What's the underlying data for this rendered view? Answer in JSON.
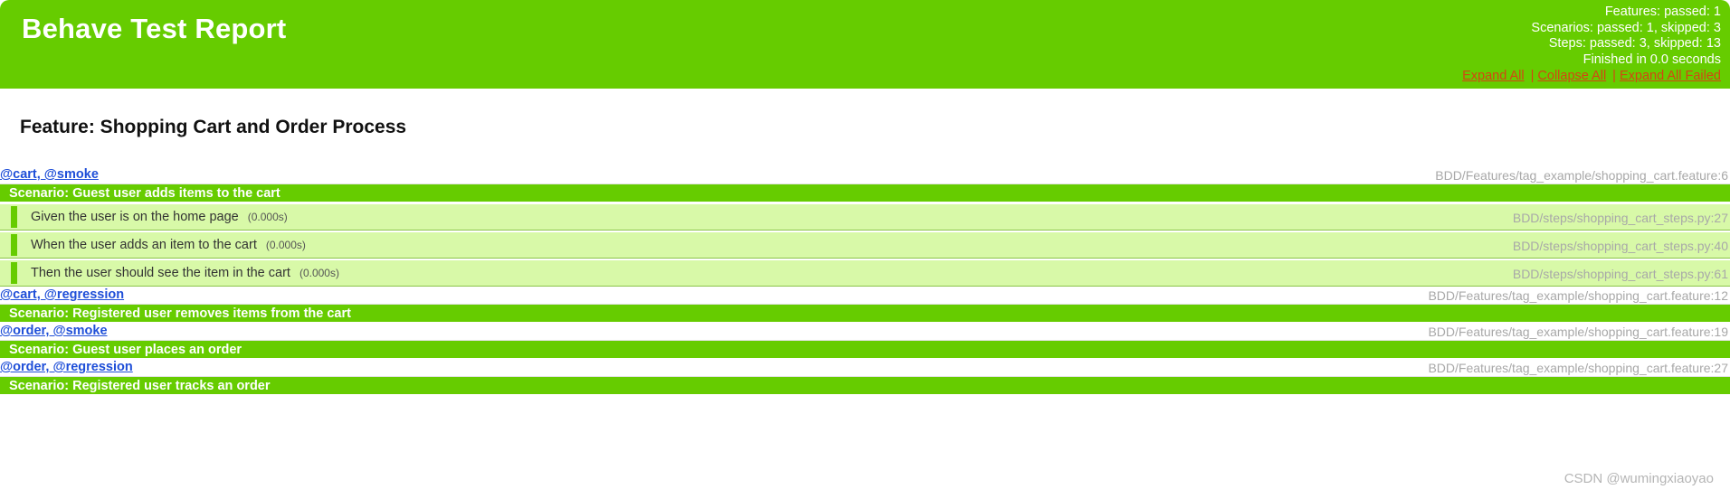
{
  "header": {
    "title": "Behave Test Report",
    "stats": {
      "features": "Features: passed: 1",
      "scenarios": "Scenarios: passed: 1, skipped: 3",
      "steps": "Steps: passed: 3, skipped: 13",
      "finished": "Finished in 0.0 seconds"
    },
    "links": {
      "expand_all": "Expand All",
      "collapse_all": "Collapse All",
      "expand_all_failed": "Expand All Failed",
      "separator": "|"
    },
    "colors": {
      "background": "#66cc00",
      "title_text": "#ffffff",
      "link_text": "#d34612"
    }
  },
  "feature": {
    "title": "Feature: Shopping Cart and Order Process"
  },
  "scenarios": [
    {
      "tags": "@cart, @smoke",
      "file_ref": "BDD/Features/tag_example/shopping_cart.feature:6",
      "name": "Scenario: Guest user adds items to the cart",
      "expanded": true,
      "steps": [
        {
          "text": "Given the user is on the home page",
          "duration": "(0.000s)",
          "file_ref": "BDD/steps/shopping_cart_steps.py:27"
        },
        {
          "text": "When the user adds an item to the cart",
          "duration": "(0.000s)",
          "file_ref": "BDD/steps/shopping_cart_steps.py:40"
        },
        {
          "text": "Then the user should see the item in the cart",
          "duration": "(0.000s)",
          "file_ref": "BDD/steps/shopping_cart_steps.py:61"
        }
      ]
    },
    {
      "tags": "@cart, @regression",
      "file_ref": "BDD/Features/tag_example/shopping_cart.feature:12",
      "name": "Scenario: Registered user removes items from the cart",
      "expanded": false,
      "steps": []
    },
    {
      "tags": "@order, @smoke",
      "file_ref": "BDD/Features/tag_example/shopping_cart.feature:19",
      "name": "Scenario: Guest user places an order",
      "expanded": false,
      "steps": []
    },
    {
      "tags": "@order, @regression",
      "file_ref": "BDD/Features/tag_example/shopping_cart.feature:27",
      "name": "Scenario: Registered user tracks an order",
      "expanded": false,
      "steps": []
    }
  ],
  "watermark": "CSDN @wumingxiaoyao"
}
